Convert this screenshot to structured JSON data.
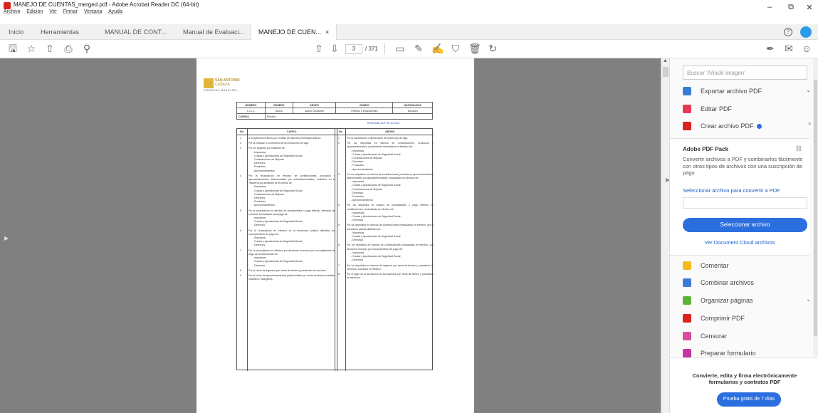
{
  "window": {
    "title": "MANEJO DE CUENTAS_merged.pdf - Adobe Acrobat Reader DC (64-bit)",
    "menu": [
      "Archivo",
      "Edición",
      "Ver",
      "Firmar",
      "Ventana",
      "Ayuda"
    ],
    "controls": {
      "minimize": "–",
      "restore": "⧉",
      "close": "✕"
    }
  },
  "tabs": {
    "home": "Inicio",
    "tools": "Herramientas",
    "items": [
      {
        "label": "MANUAL DE CONT..."
      },
      {
        "label": "Manual de Evaluaci..."
      },
      {
        "label": "MANEJO DE CUEN..."
      }
    ],
    "close_symbol": "×",
    "help_symbol": "?"
  },
  "toolbar": {
    "current_page": "3",
    "total_pages": "/ 371"
  },
  "document": {
    "logo": {
      "line1": "SAN ANTONIO",
      "line2": "CAÑADA",
      "line3": "GOBIERNO MUNICIPAL"
    },
    "header": {
      "columns": [
        "NUMERO",
        "GENERO",
        "GRUPO",
        "RUBRO",
        "NATURALEZA"
      ],
      "values": [
        "1.1.1.1",
        "Activo",
        "Activo Circulante",
        "Efectivo y Equivalentes",
        "Deudora"
      ],
      "cuenta_label": "CUENTA",
      "cuenta_value": "Efectivo"
    },
    "reformado": "Reformado DOF 00-12-2021",
    "table_head": {
      "no": "No.",
      "cargo": "CARGO",
      "no2": "No.",
      "abono": "ABONO"
    },
    "cargo": [
      {
        "n": "1",
        "t": "A la apertura en libros por el saldo del ejercicio inmediato anterior.",
        "subs": []
      },
      {
        "n": "2",
        "t": "Por la creación o incremento de los fondos fijo de caja.",
        "subs": []
      },
      {
        "n": "3",
        "t": "Por los ingresos por clasificar de:",
        "subs": [
          "Impuestos",
          "Cuotas y Aportaciones de Seguridad Social",
          "Contribuciones de Mejoras",
          "Derechos",
          "Productos",
          "Aprovechamientos"
        ]
      },
      {
        "n": "4",
        "t": "Por la recaudación en efectivo de contribuciones, productos y aprovechamientos determinables y/o autodeterminables, recibidos en la Tesorería y/o auxiliares de la misma de:",
        "subs": [
          "Impuestos",
          "Cuotas y Aportaciones de Seguridad Social",
          "Contribuciones de Mejoras",
          "Derechos",
          "Productos",
          "Aprovechamientos"
        ]
      },
      {
        "n": "5",
        "t": "Por la recaudación en efectivo de parcialidades o pago diferido, derivado del convenio formalizado para pago de:",
        "subs": [
          "Impuestos",
          "Cuotas y Aportaciones de Seguridad Social",
          "Derechos"
        ]
      },
      {
        "n": "6",
        "t": "Por la recaudación en efectivo de la resolución judicial definitiva por incumplimiento de pago de:",
        "subs": [
          "Impuestos",
          "Cuotas y Aportaciones de Seguridad Social",
          "Derechos"
        ]
      },
      {
        "n": "7",
        "t": "Por la recaudación en efectivo por deudores morosos por incumplimiento de pago de contribuciones de:",
        "subs": [
          "Impuestos",
          "Cuotas y Aportaciones de Seguridad Social",
          "Derechos"
        ]
      },
      {
        "n": "8",
        "t": "Por el cobro de ingresos por venta de bienes y prestación de servicios.",
        "subs": []
      },
      {
        "n": "9",
        "t": "Por el cobro de aprovechamientos patrimoniales por venta de bienes muebles, inuebles e intangibles.",
        "subs": []
      }
    ],
    "abono": [
      {
        "n": "1",
        "t": "Por la cancelación o disminución de fondos fijo de caja.",
        "subs": []
      },
      {
        "n": "2",
        "t": "Por los depósitos en bancos de contribuciones, productos y aprovechamientos, previamente recaudados en efectivo de:",
        "subs": [
          "Impuestos",
          "Cuotas y Aportaciones de Seguridad Social",
          "Contribuciones de Mejoras",
          "Derechos",
          "Productos",
          "Aprovechamientos"
        ]
      },
      {
        "n": "3",
        "t": "Por los depósitos en bancos de contribuciones, productos y aprovechamientos determinables y/o autodeterminables, recaudados en efectivo de:",
        "subs": [
          "Impuestos",
          "Cuotas y Aportaciones de Seguridad Social",
          "Contribuciones de Mejoras",
          "Derechos",
          "Productos",
          "Aprovechamientos"
        ]
      },
      {
        "n": "4",
        "t": "Por los depósitos en bancos de parcialidades o pago diferido en contribuciones, recaudadas en efectivo de:",
        "subs": [
          "Impuestos",
          "Cuotas y Aportaciones de Seguridad Social",
          "Derechos"
        ]
      },
      {
        "n": "5",
        "t": "Por los depósitos en bancos de contribuciones recaudadas en efectivo, por la resolución judicial definitiva de:",
        "subs": [
          "Impuestos",
          "Cuotas y Aportaciones de Seguridad Social",
          "Derechos"
        ]
      },
      {
        "n": "6",
        "t": "Por los depósitos en bancos de contribuciones recaudadas en efectivo, por deudores morosos por incumplimiento de pago de:",
        "subs": [
          "Impuestos",
          "Cuotas y Aportaciones de Seguridad Social",
          "Derechos"
        ]
      },
      {
        "n": "7",
        "t": "Por los depósitos en bancos de ingresos por venta de bienes y prestación de servicios, cobrados en efectivo.",
        "subs": []
      },
      {
        "n": "8",
        "t": "Por el pago de la devolución de los ingresos por venta de bienes y prestación de servicios.",
        "subs": []
      }
    ]
  },
  "panel": {
    "search_placeholder": "Buscar 'Añadir imagen'",
    "tools_top": [
      {
        "label": "Exportar archivo PDF",
        "chev": "⌄",
        "color": "#3b7bd8"
      },
      {
        "label": "Editar PDF",
        "chev": "",
        "color": "#e8384f"
      },
      {
        "label": "Crear archivo PDF",
        "chev": "^",
        "color": "#d9231d"
      }
    ],
    "pack": {
      "title": "Adobe PDF Pack",
      "desc": "Convertir archivos a PDF y combinarlos fácilmente con otros tipos de archivos con una suscripción de pago",
      "link": "Seleccionar archivo para convertir a PDF",
      "button": "Seleccionar archivo",
      "cloud": "Ver Document Cloud archivos"
    },
    "tools_bottom": [
      {
        "label": "Comentar",
        "chev": "",
        "color": "#f5b91e"
      },
      {
        "label": "Combinar archivos",
        "chev": "",
        "color": "#3b7bd8"
      },
      {
        "label": "Organizar páginas",
        "chev": "⌄",
        "color": "#5bb33b"
      },
      {
        "label": "Comprimir PDF",
        "chev": "",
        "color": "#d9231d"
      },
      {
        "label": "Censurar",
        "chev": "",
        "color": "#d94d9c"
      },
      {
        "label": "Preparar formulario",
        "chev": "",
        "color": "#c4359f"
      }
    ],
    "promo": {
      "text": "Convierte, edita y firma electrónicamente formularios y contratos PDF",
      "button": "Prueba gratis de 7 días"
    }
  }
}
